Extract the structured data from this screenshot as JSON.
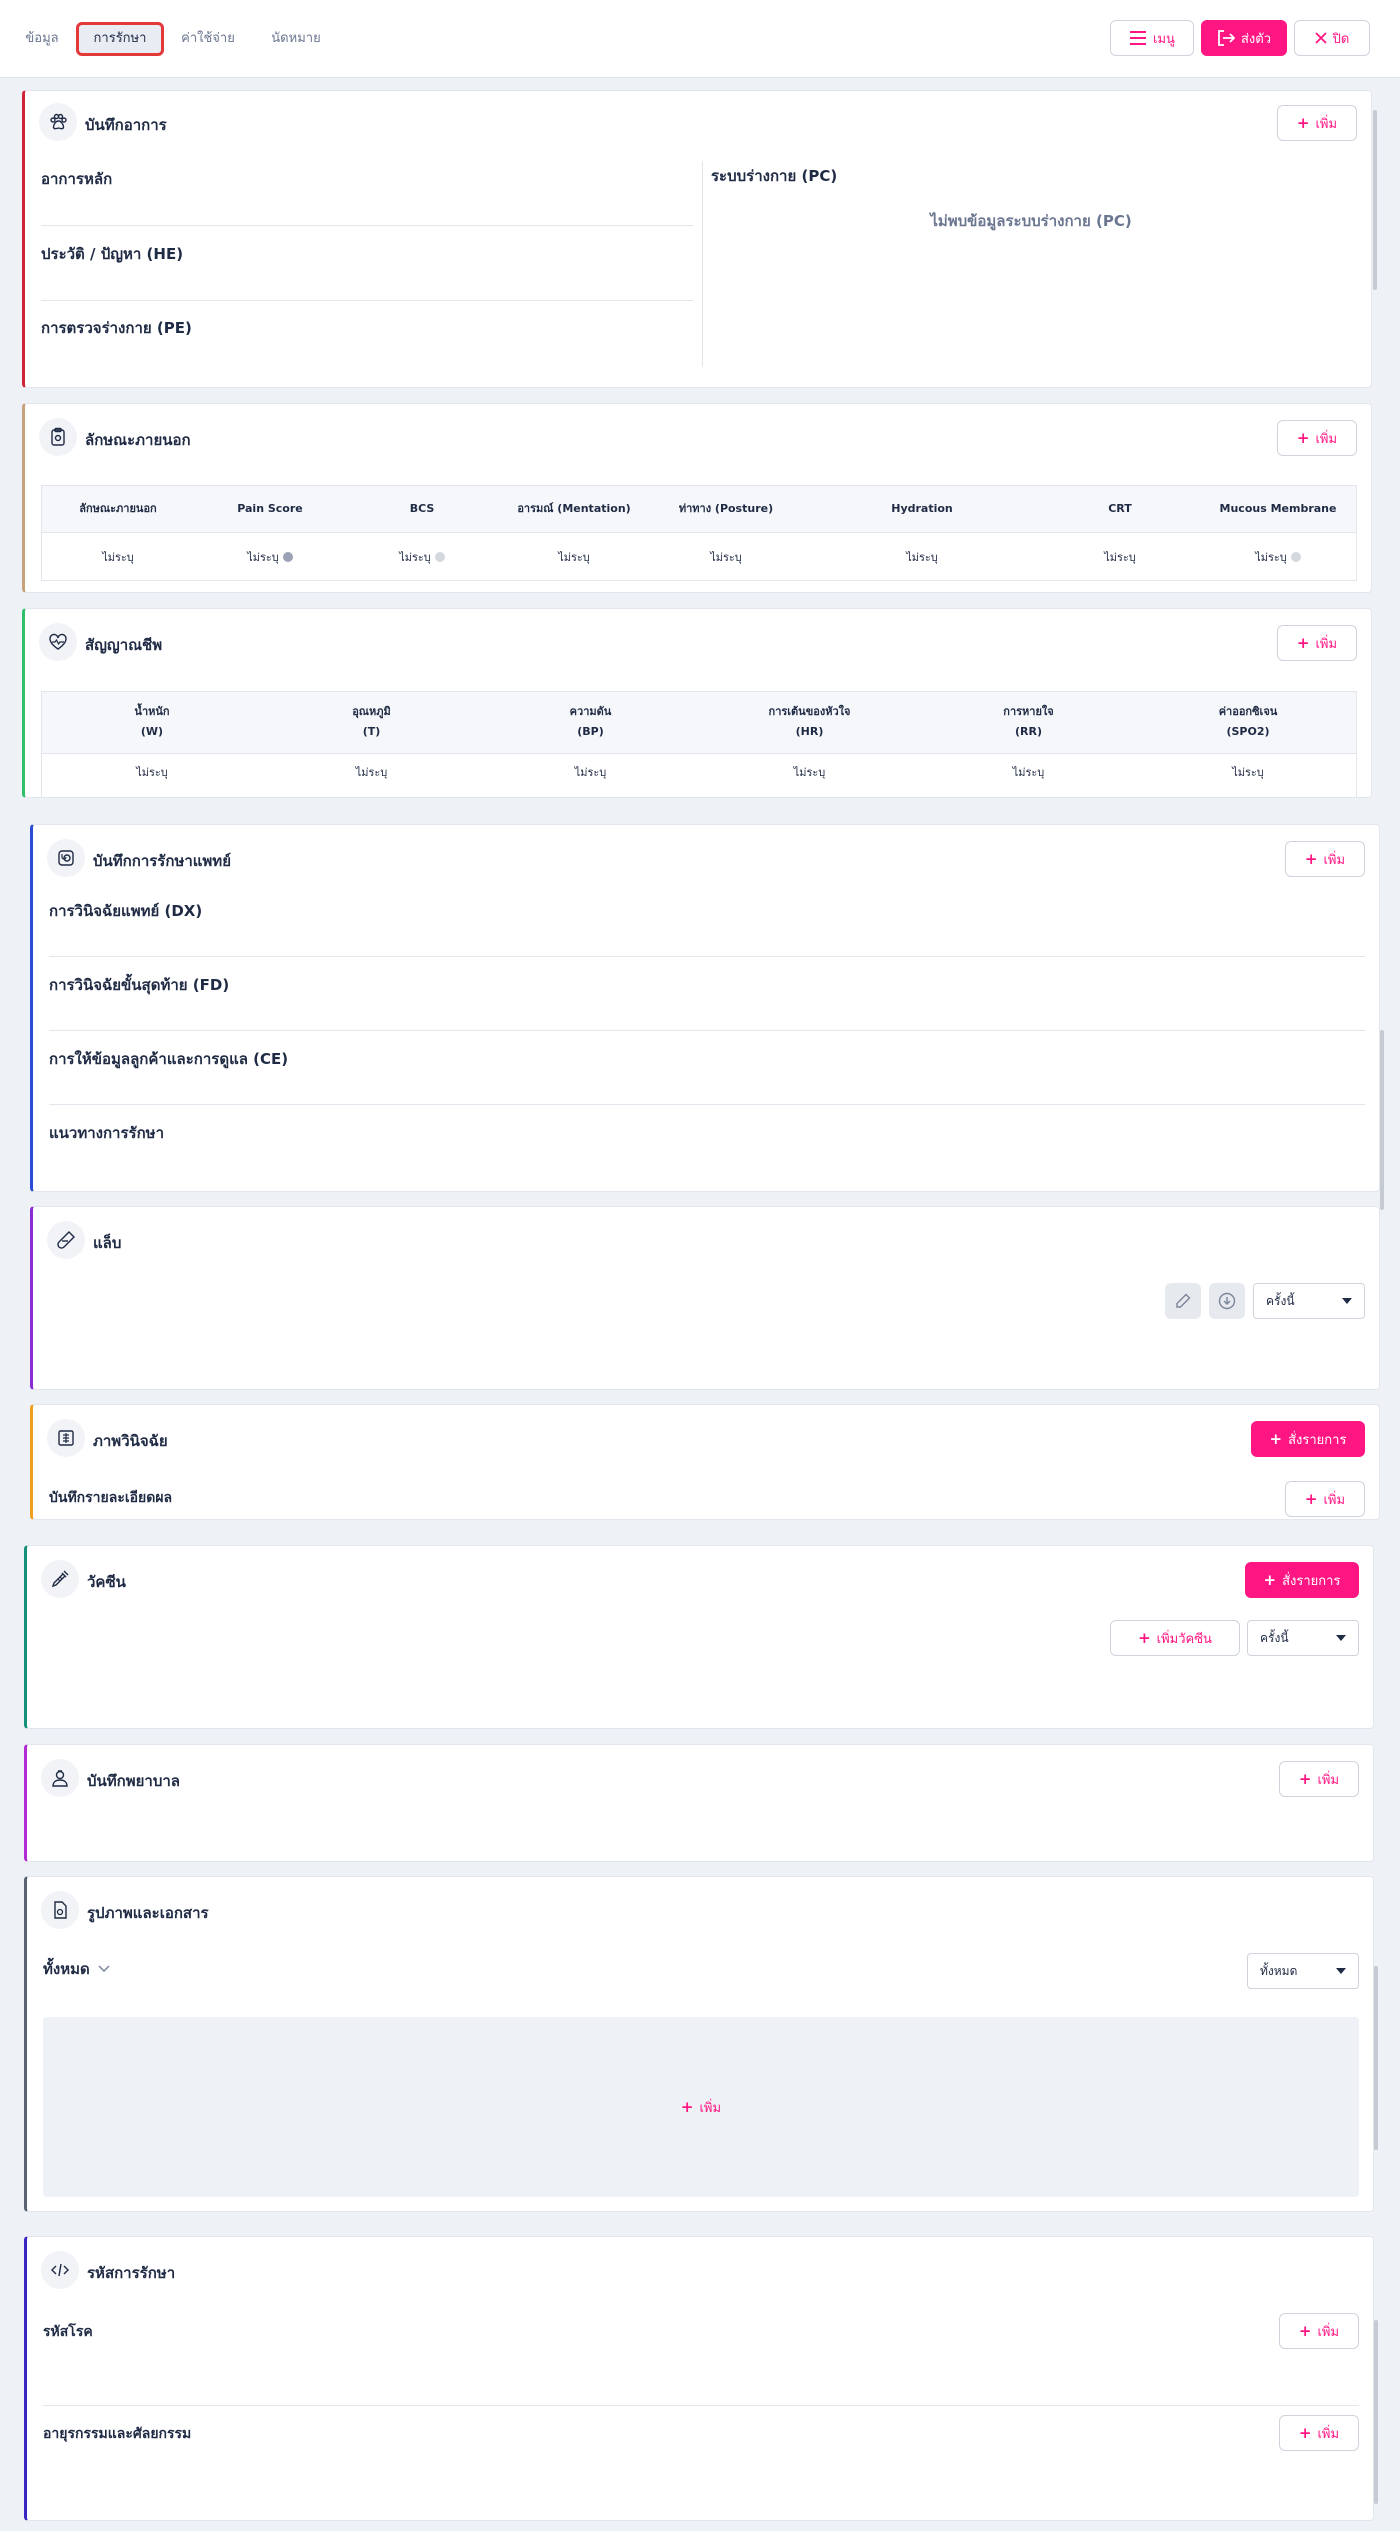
{
  "tabs": [
    {
      "label": "ข้อมูล"
    },
    {
      "label": "การรักษา"
    },
    {
      "label": "ค่าใช้จ่าย"
    },
    {
      "label": "นัดหมาย"
    }
  ],
  "header_buttons": {
    "menu": "เมนู",
    "transfer": "ส่งตัว",
    "close": "ปิด"
  },
  "add_label": "เพิ่ม",
  "symptoms": {
    "title": "บันทึกอาการ",
    "chief_complaint": "อาการหลัก",
    "history": "ประวัติ / ปัญหา (HE)",
    "physical_exam": "การตรวจร่างกาย (PE)",
    "body_system": "ระบบร่างกาย (PC)",
    "body_system_empty": "ไม่พบข้อมูลระบบร่างกาย (PC)"
  },
  "appearance": {
    "title": "ลักษณะภายนอก",
    "columns": [
      "ลักษณะภายนอก",
      "Pain Score",
      "BCS",
      "อารมณ์ (Mentation)",
      "ท่าทาง (Posture)",
      "Hydration",
      "CRT",
      "Mucous Membrane"
    ],
    "values": [
      "ไม่ระบุ",
      "ไม่ระบุ",
      "ไม่ระบุ",
      "ไม่ระบุ",
      "ไม่ระบุ",
      "ไม่ระบุ",
      "ไม่ระบุ",
      "ไม่ระบุ"
    ]
  },
  "vitals": {
    "title": "สัญญาณชีพ",
    "columns": [
      {
        "name": "น้ำหนัก",
        "unit": "(W)"
      },
      {
        "name": "อุณหภูมิ",
        "unit": "(T)"
      },
      {
        "name": "ความดัน",
        "unit": "(BP)"
      },
      {
        "name": "การเต้นของหัวใจ",
        "unit": "(HR)"
      },
      {
        "name": "การหายใจ",
        "unit": "(RR)"
      },
      {
        "name": "ค่าออกซิเจน",
        "unit": "(SPO2)"
      }
    ],
    "values": [
      "ไม่ระบุ",
      "ไม่ระบุ",
      "ไม่ระบุ",
      "ไม่ระบุ",
      "ไม่ระบุ",
      "ไม่ระบุ"
    ]
  },
  "doctor_notes": {
    "title": "บันทึกการรักษาแพทย์",
    "dx": "การวินิจฉัยแพทย์ (DX)",
    "fd": "การวินิจฉัยขั้นสุดท้าย (FD)",
    "ce": "การให้ข้อมูลลูกค้าและการดูแล (CE)",
    "plan": "แนวทางการรักษา"
  },
  "lab": {
    "title": "แล็บ",
    "select": "ครั้งนี้"
  },
  "imaging": {
    "title": "ภาพวินิจฉัย",
    "order": "สั่งรายการ",
    "record": "บันทึกรายละเอียดผล"
  },
  "vaccine": {
    "title": "วัคซีน",
    "order": "สั่งรายการ",
    "add_vaccine": "เพิ่มวัคซีน",
    "select": "ครั้งนี้"
  },
  "nurse": {
    "title": "บันทึกพยาบาล"
  },
  "documents": {
    "title": "รูปภาพและเอกสาร",
    "filter": "ทั้งหมด",
    "select": "ทั้งหมด"
  },
  "codes": {
    "title": "รหัสการรักษา",
    "disease": "รหัสโรค",
    "procedure": "อายุรกรรมและศัลยกรรม"
  }
}
